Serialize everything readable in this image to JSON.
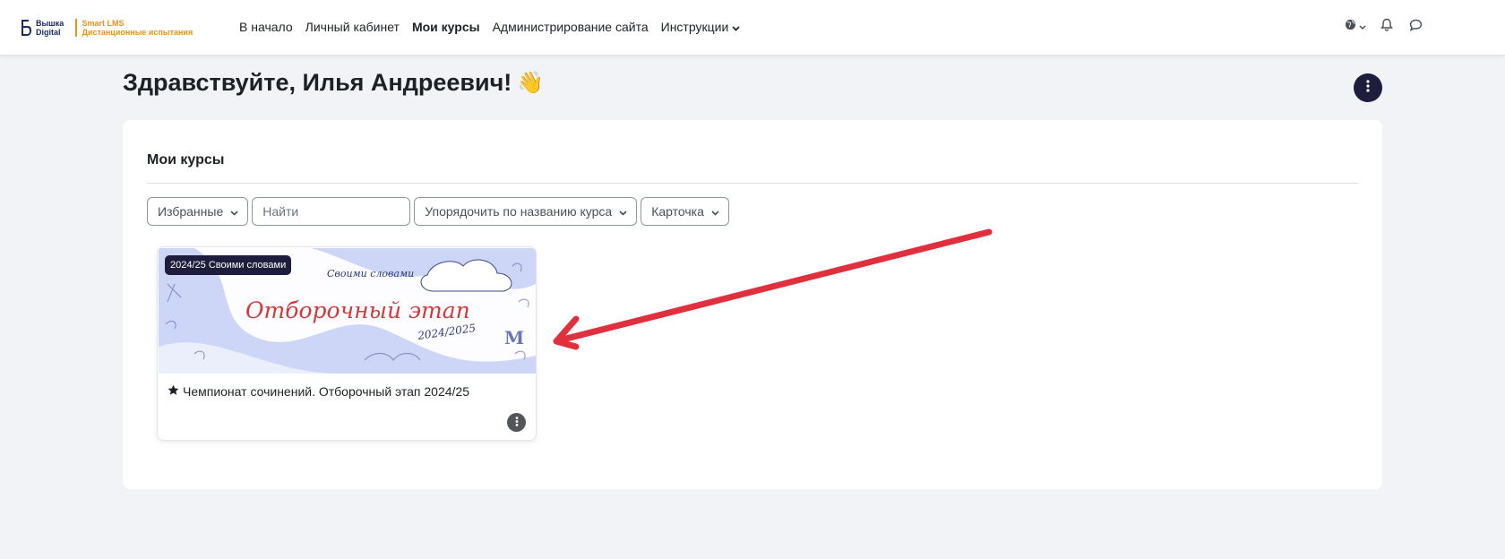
{
  "navbar": {
    "logo": {
      "brand_line1": "Вышка",
      "brand_line2": "Digital",
      "sub_line1": "Smart LMS",
      "sub_line2": "Дистанционные испытания"
    },
    "links": [
      {
        "label": "В начало",
        "active": false
      },
      {
        "label": "Личный кабинет",
        "active": false
      },
      {
        "label": "Мои курсы",
        "active": true
      },
      {
        "label": "Администрирование сайта",
        "active": false
      },
      {
        "label": "Инструкции",
        "active": false,
        "has_dropdown": true
      }
    ],
    "right_icons": [
      "globe-icon",
      "bell-icon",
      "chat-icon"
    ]
  },
  "page": {
    "greeting": "Здравствуйте, Илья Андреевич!",
    "greeting_emoji": "👋"
  },
  "my_courses": {
    "title": "Мои курсы",
    "filters": {
      "grouping": "Избранные",
      "search_placeholder": "Найти",
      "sort": "Упорядочить по названию курса",
      "view": "Карточка"
    },
    "courses": [
      {
        "badge": "2024/25 Своими словами",
        "image_title": "Отборочный этап",
        "image_small_title": "Своими словами",
        "image_year": "2024/2025",
        "name": "Чемпионат сочинений. Отборочный этап 2024/25",
        "starred": true
      }
    ]
  },
  "colors": {
    "accent_dark": "#1f1d3d",
    "logo_orange": "#e8911f",
    "logo_navy": "#1b2a5e",
    "annotation_red": "#e0303e",
    "page_bg": "#f2f3f6"
  }
}
